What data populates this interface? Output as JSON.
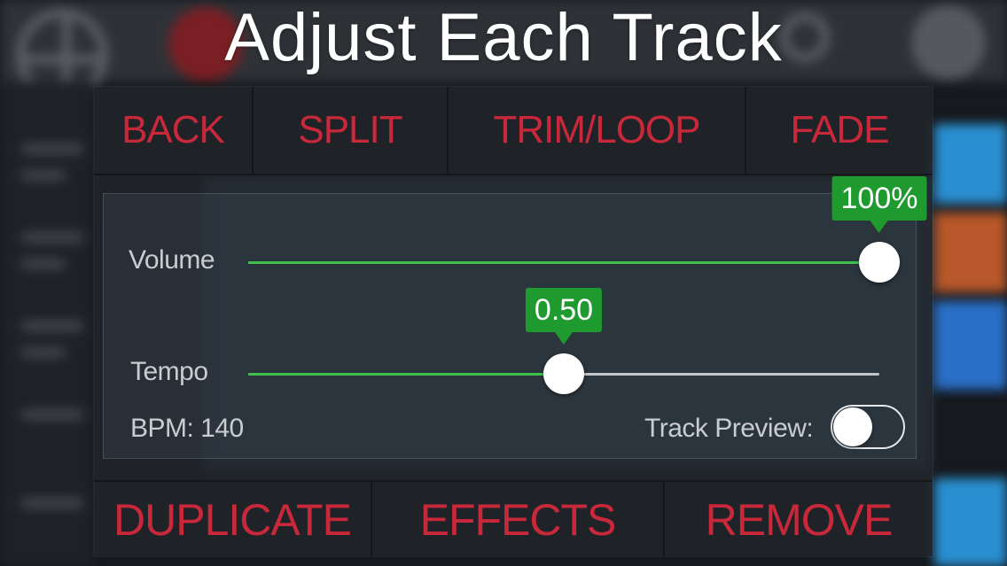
{
  "title": "Adjust Each Track",
  "colors": {
    "accent_red": "#c8283a",
    "slider_green": "#3fc04c",
    "tooltip_green": "#1f9a2e"
  },
  "top_menu": {
    "back": "BACK",
    "split": "SPLIT",
    "trim_loop": "TRIM/LOOP",
    "fade": "FADE"
  },
  "volume": {
    "label": "Volume",
    "value_label": "100%",
    "fraction": 1.0
  },
  "tempo": {
    "label": "Tempo",
    "value_label": "0.50",
    "fraction": 0.5
  },
  "bpm": {
    "text": "BPM: 140"
  },
  "track_preview": {
    "label": "Track Preview:",
    "on": false
  },
  "bottom_menu": {
    "duplicate": "DUPLICATE",
    "effects": "EFFECTS",
    "remove": "REMOVE"
  },
  "background_icons": [
    "crosshair-icon",
    "record-icon",
    "search-icon",
    "gear-icon"
  ]
}
